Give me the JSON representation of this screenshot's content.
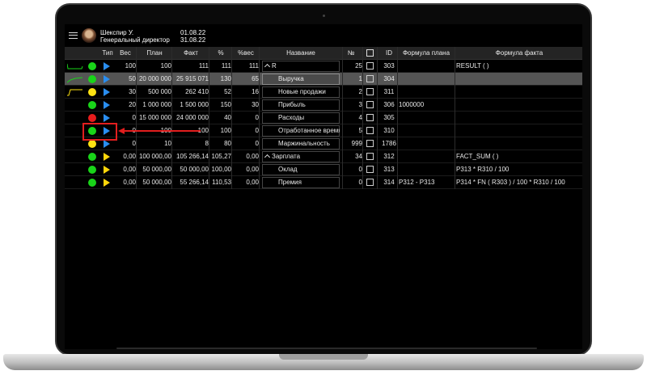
{
  "header": {
    "user_name": "Шекспир У.",
    "user_role": "Генеральный директор",
    "date_from": "01.08.22",
    "date_to": "31.08.22"
  },
  "columns": {
    "type": "Тип",
    "weight": "Вес",
    "plan": "План",
    "fact": "Факт",
    "pct": "%",
    "pct_weight": "%вес",
    "name": "Название",
    "num": "№",
    "id": "ID",
    "formula_plan": "Формула плана",
    "formula_fact": "Формула факта"
  },
  "rows": [
    {
      "spark": "flat",
      "dot": "green",
      "tri": "blue",
      "weight": "100",
      "plan": "100",
      "fact": "111",
      "pct": "111",
      "pct_weight": "111",
      "name": "R",
      "caret": true,
      "num": "25",
      "id": "303",
      "formula_plan": "",
      "formula_fact": "RESULT ( )",
      "selected": false
    },
    {
      "spark": "up",
      "dot": "green",
      "tri": "blue",
      "weight": "50",
      "plan": "20 000 000",
      "fact": "25 915 071",
      "pct": "130",
      "pct_weight": "65",
      "name": "Выручка",
      "caret": false,
      "num": "1",
      "id": "304",
      "formula_plan": "",
      "formula_fact": "",
      "selected": true
    },
    {
      "spark": "step",
      "dot": "yellow",
      "tri": "blue",
      "weight": "30",
      "plan": "500 000",
      "fact": "262 410",
      "pct": "52",
      "pct_weight": "16",
      "name": "Новые продажи",
      "caret": false,
      "num": "2",
      "id": "311",
      "formula_plan": "",
      "formula_fact": "",
      "selected": false
    },
    {
      "spark": "",
      "dot": "green",
      "tri": "blue",
      "weight": "20",
      "plan": "1 000 000",
      "fact": "1 500 000",
      "pct": "150",
      "pct_weight": "30",
      "name": "Прибыль",
      "caret": false,
      "num": "3",
      "id": "306",
      "formula_plan": "1000000",
      "formula_fact": "",
      "selected": false
    },
    {
      "spark": "",
      "dot": "red",
      "tri": "blue",
      "weight": "0",
      "plan": "15 000 000",
      "fact": "24 000 000",
      "pct": "40",
      "pct_weight": "0",
      "name": "Расходы",
      "caret": false,
      "num": "4",
      "id": "305",
      "formula_plan": "",
      "formula_fact": "",
      "selected": false
    },
    {
      "spark": "",
      "dot": "green",
      "tri": "blue",
      "weight": "0",
      "plan": "100",
      "fact": "100",
      "pct": "100",
      "pct_weight": "0",
      "name": "Отработанное время",
      "caret": false,
      "num": "5",
      "id": "310",
      "formula_plan": "",
      "formula_fact": "",
      "selected": false
    },
    {
      "spark": "",
      "dot": "yellow",
      "tri": "blue",
      "weight": "0",
      "plan": "10",
      "fact": "8",
      "pct": "80",
      "pct_weight": "0",
      "name": "Маржинальность",
      "caret": false,
      "num": "999",
      "id": "1786",
      "formula_plan": "",
      "formula_fact": "",
      "selected": false
    },
    {
      "spark": "",
      "dot": "green",
      "tri": "yellow",
      "weight": "0,00",
      "plan": "100 000,00",
      "fact": "105 266,14",
      "pct": "105,27",
      "pct_weight": "0,00",
      "name": "Зарплата",
      "caret": true,
      "num": "34",
      "id": "312",
      "formula_plan": "",
      "formula_fact": "FACT_SUM ( )",
      "selected": false
    },
    {
      "spark": "",
      "dot": "green",
      "tri": "yellow",
      "weight": "0,00",
      "plan": "50 000,00",
      "fact": "50 000,00",
      "pct": "100,00",
      "pct_weight": "0,00",
      "name": "Оклад",
      "caret": false,
      "num": "0",
      "id": "313",
      "formula_plan": "",
      "formula_fact": "P313 * R310 / 100",
      "selected": false
    },
    {
      "spark": "",
      "dot": "green",
      "tri": "yellow",
      "weight": "0,00",
      "plan": "50 000,00",
      "fact": "55 266,14",
      "pct": "110,53",
      "pct_weight": "0,00",
      "name": "Премия",
      "caret": false,
      "num": "0",
      "id": "314",
      "formula_plan": "P312 - P313",
      "formula_fact": "P314 * FN ( R303 ) / 100 * R310 / 100",
      "selected": false
    }
  ],
  "colors": {
    "green": "#19d419",
    "yellow": "#ffe313",
    "red": "#e81c1c",
    "blue_triangle": "#2a8ef0",
    "highlight": "#e21e1e"
  }
}
